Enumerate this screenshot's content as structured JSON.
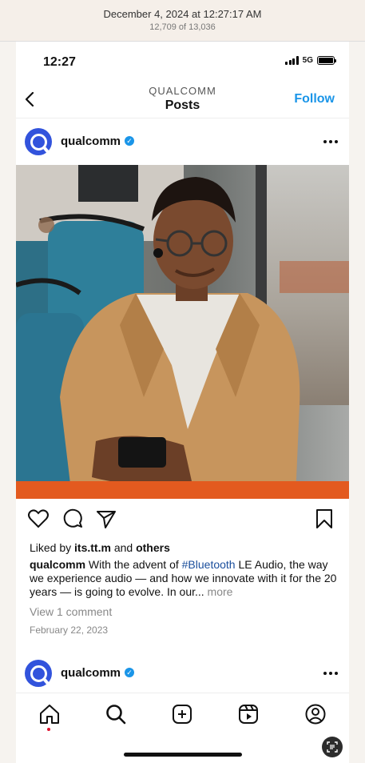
{
  "meta": {
    "date": "December 4, 2024 at 12:27:17 AM",
    "count": "12,709 of 13,036"
  },
  "status": {
    "time": "12:27",
    "network": "5G"
  },
  "nav": {
    "subtitle": "QUALCOMM",
    "title": "Posts",
    "follow": "Follow"
  },
  "post": {
    "username": "qualcomm",
    "liked_by_prefix": "Liked by ",
    "liked_by_user": "its.tt.m",
    "liked_by_and": " and ",
    "liked_by_others": "others",
    "caption_user": "qualcomm",
    "caption_pre": " With the advent of ",
    "caption_hashtag": "#Bluetooth",
    "caption_post": " LE Audio, the way we experience audio — and how we innovate with it for the 20 years — is going to evolve. In our...",
    "caption_more": " more",
    "comments": "View 1 comment",
    "date": "February 22, 2023"
  },
  "next_post": {
    "username": "qualcomm"
  },
  "colors": {
    "accent": "#1a95e8",
    "avatar": "#3253dc"
  },
  "icons": [
    "back-icon",
    "heart-icon",
    "comment-icon",
    "share-icon",
    "bookmark-icon",
    "home-icon",
    "search-icon",
    "create-icon",
    "reels-icon",
    "profile-icon"
  ]
}
